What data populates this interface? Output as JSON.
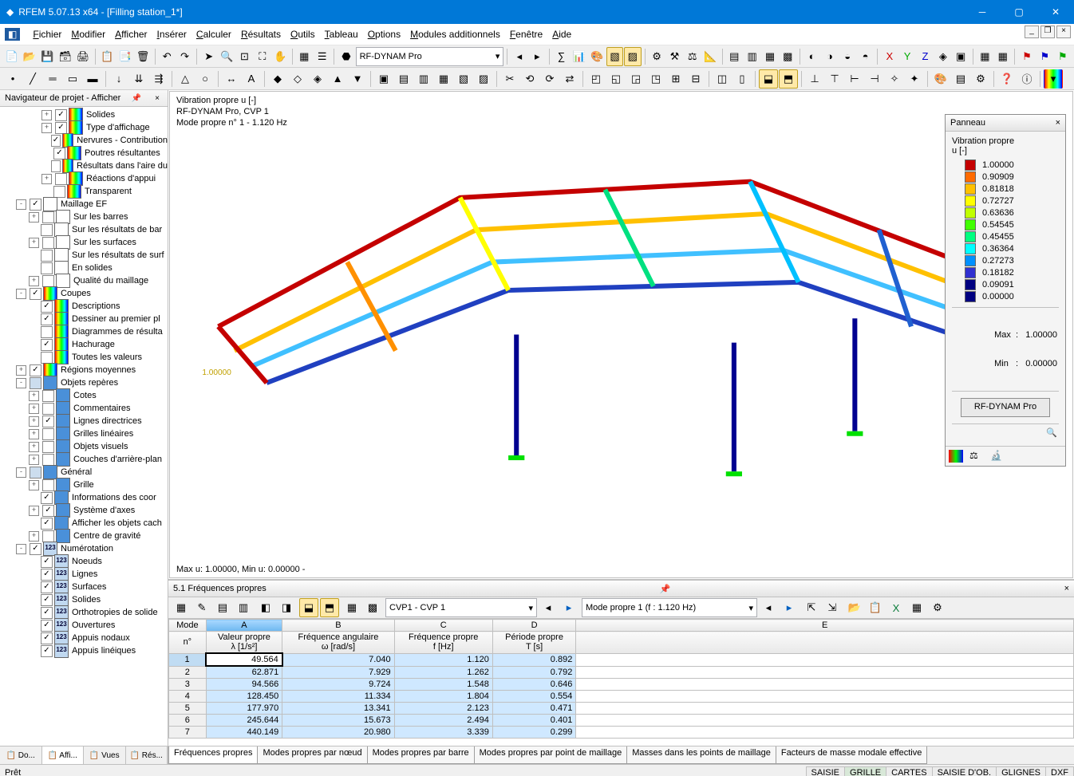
{
  "colors": {
    "accent": "#0078d7",
    "legend": [
      "#c40000",
      "#ff6a00",
      "#ffc000",
      "#ffff00",
      "#c0ff00",
      "#40ff00",
      "#00ff80",
      "#00ffff",
      "#0090ff",
      "#3030d0",
      "#000080"
    ]
  },
  "title": "RFEM 5.07.13 x64 - [Filling station_1*]",
  "menu": [
    "Fichier",
    "Modifier",
    "Afficher",
    "Insérer",
    "Calculer",
    "Résultats",
    "Outils",
    "Tableau",
    "Options",
    "Modules additionnels",
    "Fenêtre",
    "Aide"
  ],
  "toolbar_combo": "RF-DYNAM Pro",
  "navigator": {
    "title": "Navigateur de projet - Afficher",
    "tabs": [
      "Do...",
      "Affi...",
      "Vues",
      "Rés..."
    ],
    "items": [
      {
        "ind": 3,
        "exp": "+",
        "cb": "c",
        "ico": "rb",
        "lbl": "Solides"
      },
      {
        "ind": 3,
        "exp": "+",
        "cb": "c",
        "ico": "rb",
        "lbl": "Type d'affichage"
      },
      {
        "ind": 3,
        "exp": "",
        "cb": "c",
        "ico": "rb",
        "lbl": "Nervures - Contribution"
      },
      {
        "ind": 3,
        "exp": "",
        "cb": "c",
        "ico": "rb",
        "lbl": "Poutres résultantes"
      },
      {
        "ind": 3,
        "exp": "",
        "cb": "",
        "ico": "rb",
        "lbl": "Résultats dans l'aire du"
      },
      {
        "ind": 3,
        "exp": "+",
        "cb": "",
        "ico": "rb",
        "lbl": "Réactions d'appui"
      },
      {
        "ind": 3,
        "exp": "",
        "cb": "",
        "ico": "rb",
        "lbl": "Transparent"
      },
      {
        "ind": 1,
        "exp": "-",
        "cb": "c",
        "ico": "pl",
        "lbl": "Maillage EF"
      },
      {
        "ind": 2,
        "exp": "+",
        "cb": "",
        "ico": "pl",
        "lbl": "Sur les barres"
      },
      {
        "ind": 2,
        "exp": "",
        "cb": "",
        "ico": "pl",
        "lbl": "Sur les résultats de bar"
      },
      {
        "ind": 2,
        "exp": "+",
        "cb": "",
        "ico": "pl",
        "lbl": "Sur les surfaces"
      },
      {
        "ind": 2,
        "exp": "",
        "cb": "",
        "ico": "pl",
        "lbl": "Sur les résultats de surf"
      },
      {
        "ind": 2,
        "exp": "",
        "cb": "",
        "ico": "pl",
        "lbl": "En solides"
      },
      {
        "ind": 2,
        "exp": "+",
        "cb": "",
        "ico": "pl",
        "lbl": "Qualité du maillage"
      },
      {
        "ind": 1,
        "exp": "-",
        "cb": "c",
        "ico": "rb",
        "lbl": "Coupes"
      },
      {
        "ind": 2,
        "exp": "",
        "cb": "c",
        "ico": "rb",
        "lbl": "Descriptions"
      },
      {
        "ind": 2,
        "exp": "",
        "cb": "c",
        "ico": "rb",
        "lbl": "Dessiner au premier pl"
      },
      {
        "ind": 2,
        "exp": "",
        "cb": "",
        "ico": "rb",
        "lbl": "Diagrammes de résulta"
      },
      {
        "ind": 2,
        "exp": "",
        "cb": "c",
        "ico": "rb",
        "lbl": "Hachurage"
      },
      {
        "ind": 2,
        "exp": "",
        "cb": "",
        "ico": "rb",
        "lbl": "Toutes les valeurs"
      },
      {
        "ind": 1,
        "exp": "+",
        "cb": "c",
        "ico": "rb",
        "lbl": "Régions moyennes"
      },
      {
        "ind": 1,
        "exp": "-",
        "cb": "m",
        "ico": "bl",
        "lbl": "Objets repères"
      },
      {
        "ind": 2,
        "exp": "+",
        "cb": "",
        "ico": "bl",
        "lbl": "Cotes"
      },
      {
        "ind": 2,
        "exp": "+",
        "cb": "",
        "ico": "bl",
        "lbl": "Commentaires"
      },
      {
        "ind": 2,
        "exp": "+",
        "cb": "c",
        "ico": "bl",
        "lbl": "Lignes directrices"
      },
      {
        "ind": 2,
        "exp": "+",
        "cb": "",
        "ico": "bl",
        "lbl": "Grilles linéaires"
      },
      {
        "ind": 2,
        "exp": "+",
        "cb": "",
        "ico": "bl",
        "lbl": "Objets visuels"
      },
      {
        "ind": 2,
        "exp": "+",
        "cb": "",
        "ico": "bl",
        "lbl": "Couches d'arrière-plan"
      },
      {
        "ind": 1,
        "exp": "-",
        "cb": "m",
        "ico": "bl",
        "lbl": "Général"
      },
      {
        "ind": 2,
        "exp": "+",
        "cb": "",
        "ico": "bl",
        "lbl": "Grille"
      },
      {
        "ind": 2,
        "exp": "",
        "cb": "c",
        "ico": "bl",
        "lbl": "Informations des coor"
      },
      {
        "ind": 2,
        "exp": "+",
        "cb": "c",
        "ico": "bl",
        "lbl": "Système d'axes"
      },
      {
        "ind": 2,
        "exp": "",
        "cb": "c",
        "ico": "bl",
        "lbl": "Afficher les objets cach"
      },
      {
        "ind": 2,
        "exp": "+",
        "cb": "",
        "ico": "bl",
        "lbl": "Centre de gravité"
      },
      {
        "ind": 1,
        "exp": "-",
        "cb": "c",
        "ico": "num",
        "lbl": "Numérotation"
      },
      {
        "ind": 2,
        "exp": "",
        "cb": "c",
        "ico": "num",
        "lbl": "Noeuds"
      },
      {
        "ind": 2,
        "exp": "",
        "cb": "c",
        "ico": "num",
        "lbl": "Lignes"
      },
      {
        "ind": 2,
        "exp": "",
        "cb": "c",
        "ico": "num",
        "lbl": "Surfaces"
      },
      {
        "ind": 2,
        "exp": "",
        "cb": "c",
        "ico": "num",
        "lbl": "Solides"
      },
      {
        "ind": 2,
        "exp": "",
        "cb": "c",
        "ico": "num",
        "lbl": "Orthotropies de solide"
      },
      {
        "ind": 2,
        "exp": "",
        "cb": "c",
        "ico": "num",
        "lbl": "Ouvertures"
      },
      {
        "ind": 2,
        "exp": "",
        "cb": "c",
        "ico": "num",
        "lbl": "Appuis nodaux"
      },
      {
        "ind": 2,
        "exp": "",
        "cb": "c",
        "ico": "num",
        "lbl": "Appuis linéiques"
      }
    ]
  },
  "viewport": {
    "line1": "Vibration propre u [-]",
    "line2": "RF-DYNAM Pro, CVP 1",
    "line3": "Mode propre n° 1 - 1.120 Hz",
    "bottom": "Max u: 1.00000, Min u: 0.00000 -",
    "marker": "1.00000"
  },
  "panel": {
    "title": "Panneau",
    "sub1": "Vibration propre",
    "sub2": "u [-]",
    "legend": [
      "1.00000",
      "0.90909",
      "0.81818",
      "0.72727",
      "0.63636",
      "0.54545",
      "0.45455",
      "0.36364",
      "0.27273",
      "0.18182",
      "0.09091",
      "0.00000"
    ],
    "max": "Max  :   1.00000",
    "min": "Min   :   0.00000",
    "button": "RF-DYNAM Pro"
  },
  "table": {
    "title": "5.1 Fréquences propres",
    "combo1": "CVP1 - CVP 1",
    "combo2": "Mode propre 1 (f : 1.120 Hz)",
    "hd_row": [
      "Mode",
      "A",
      "B",
      "C",
      "D",
      "E"
    ],
    "hd1": [
      "n°",
      "Valeur propre",
      "Fréquence angulaire",
      "Fréquence propre",
      "Période propre",
      ""
    ],
    "hd2": [
      "",
      "λ [1/s²]",
      "ω [rad/s]",
      "f [Hz]",
      "T [s]",
      ""
    ],
    "rows": [
      [
        "1",
        "49.564",
        "7.040",
        "1.120",
        "0.892"
      ],
      [
        "2",
        "62.871",
        "7.929",
        "1.262",
        "0.792"
      ],
      [
        "3",
        "94.566",
        "9.724",
        "1.548",
        "0.646"
      ],
      [
        "4",
        "128.450",
        "11.334",
        "1.804",
        "0.554"
      ],
      [
        "5",
        "177.970",
        "13.341",
        "2.123",
        "0.471"
      ],
      [
        "6",
        "245.644",
        "15.673",
        "2.494",
        "0.401"
      ],
      [
        "7",
        "440.149",
        "20.980",
        "3.339",
        "0.299"
      ]
    ],
    "tabs": [
      "Fréquences propres",
      "Modes propres par nœud",
      "Modes propres par barre",
      "Modes propres par point de maillage",
      "Masses dans les points de maillage",
      "Facteurs de masse modale effective"
    ]
  },
  "status": {
    "left": "Prêt",
    "cells": [
      "SAISIE",
      "GRILLE",
      "CARTES",
      "SAISIE D'OB.",
      "GLIGNES",
      "DXF"
    ]
  },
  "chart_data": {
    "type": "table",
    "title": "5.1 Fréquences propres",
    "columns": [
      "Mode n°",
      "Valeur propre λ [1/s²]",
      "Fréquence angulaire ω [rad/s]",
      "Fréquence propre f [Hz]",
      "Période propre T [s]"
    ],
    "rows": [
      [
        1,
        49.564,
        7.04,
        1.12,
        0.892
      ],
      [
        2,
        62.871,
        7.929,
        1.262,
        0.792
      ],
      [
        3,
        94.566,
        9.724,
        1.548,
        0.646
      ],
      [
        4,
        128.45,
        11.334,
        1.804,
        0.554
      ],
      [
        5,
        177.97,
        13.341,
        2.123,
        0.471
      ],
      [
        6,
        245.644,
        15.673,
        2.494,
        0.401
      ],
      [
        7,
        440.149,
        20.98,
        3.339,
        0.299
      ]
    ],
    "legend": {
      "title": "Vibration propre u [-]",
      "values": [
        1.0,
        0.90909,
        0.81818,
        0.72727,
        0.63636,
        0.54545,
        0.45455,
        0.36364,
        0.27273,
        0.18182,
        0.09091,
        0.0
      ],
      "colors": [
        "#c40000",
        "#ff6a00",
        "#ffc000",
        "#ffff00",
        "#c0ff00",
        "#40ff00",
        "#00ff80",
        "#00ffff",
        "#0090ff",
        "#3030d0",
        "#000080"
      ]
    }
  }
}
